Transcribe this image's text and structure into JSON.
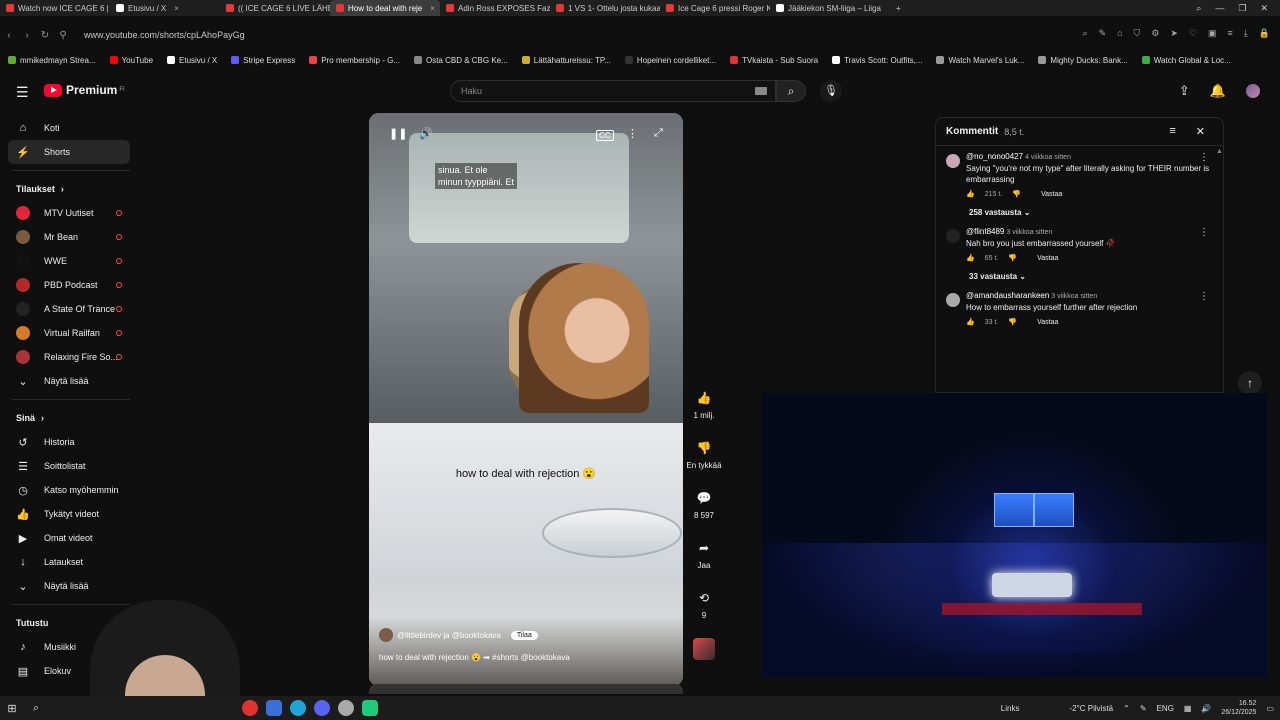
{
  "browser": {
    "tabs": [
      {
        "label": "Watch now ICE CAGE 6 | L",
        "color": "#e53935",
        "active": false
      },
      {
        "label": "Etusivu / X",
        "color": "#ffffff",
        "active": false
      },
      {
        "label": "(( ICE CAGE 6 LIVE LÄHE",
        "color": "#e53935",
        "active": false
      },
      {
        "label": "How to deal with reje",
        "color": "#e53935",
        "active": true
      },
      {
        "label": "Adin Ross EXPOSES Faze C",
        "color": "#e53935",
        "active": false
      },
      {
        "label": "1 VS 1- Ottelu josta kukaa",
        "color": "#e53935",
        "active": false
      },
      {
        "label": "Ice Cage 6 pressi Roger Ka",
        "color": "#e53935",
        "active": false
      },
      {
        "label": "Jääkiekon SM-liiga – Liiga",
        "color": "#ffffff",
        "active": false
      }
    ],
    "url": "www.youtube.com/shorts/cpLAhoPayGg",
    "bookmarks": [
      {
        "label": "mmikedmayn Strea...",
        "color": "#6a3"
      },
      {
        "label": "YouTube",
        "color": "#f00"
      },
      {
        "label": "Etusivu / X",
        "color": "#fff"
      },
      {
        "label": "Stripe Express",
        "color": "#635bff"
      },
      {
        "label": "Pro membership - G...",
        "color": "#e44"
      },
      {
        "label": "Osta CBD & CBG Ke...",
        "color": "#888"
      },
      {
        "label": "Lättähattureissu: TP...",
        "color": "#ca3"
      },
      {
        "label": "Hopeinen cordelliket...",
        "color": "#333"
      },
      {
        "label": "TVkaista - Sub Suora",
        "color": "#d33"
      },
      {
        "label": "Travis Scott: Outfits,...",
        "color": "#fff"
      },
      {
        "label": "Watch Marvel's Luk...",
        "color": "#999"
      },
      {
        "label": "Mighty Ducks: Bank...",
        "color": "#999"
      },
      {
        "label": "Watch Global & Loc...",
        "color": "#4a4"
      }
    ]
  },
  "header": {
    "logo_text": "Premium",
    "logo_sup": "FI",
    "search_placeholder": "Haku"
  },
  "sidebar": {
    "main": [
      {
        "label": "Koti",
        "icon": "⌂",
        "name": "home"
      },
      {
        "label": "Shorts",
        "icon": "⚡",
        "name": "shorts"
      }
    ],
    "subs_title": "Tilaukset",
    "subs": [
      {
        "label": "MTV Uutiset",
        "color": "#e0263a"
      },
      {
        "label": "Mr Bean",
        "color": "#7a5a40"
      },
      {
        "label": "WWE",
        "color": "#111"
      },
      {
        "label": "PBD Podcast",
        "color": "#b02a2a"
      },
      {
        "label": "A State Of Trance",
        "color": "#222"
      },
      {
        "label": "Virtual Railfan",
        "color": "#d47a2a"
      },
      {
        "label": "Relaxing Fire So...",
        "color": "#a33"
      }
    ],
    "show_more": "Näytä lisää",
    "you_title": "Sinä",
    "you": [
      {
        "label": "Historia",
        "icon": "↺",
        "name": "history"
      },
      {
        "label": "Soittolistat",
        "icon": "☰",
        "name": "playlists"
      },
      {
        "label": "Katso myöhemmin",
        "icon": "◷",
        "name": "watch-later"
      },
      {
        "label": "Tykätyt videot",
        "icon": "👍",
        "name": "liked"
      },
      {
        "label": "Omat videot",
        "icon": "▶",
        "name": "your-videos"
      },
      {
        "label": "Lataukset",
        "icon": "↓",
        "name": "downloads"
      }
    ],
    "show_more2": "Näytä lisää",
    "explore_title": "Tutustu",
    "explore": [
      {
        "label": "Musiikki",
        "icon": "♪",
        "name": "music"
      },
      {
        "label": "Elokuv",
        "icon": "▤",
        "name": "movies"
      }
    ]
  },
  "player": {
    "subtitle_line1": "sinua.  Et ole",
    "subtitle_line2": "minun tyyppiäni.  Et",
    "caption": "how to deal with rejection 😮",
    "channel": "@littlebirdev ja @booktokava",
    "subscribe": "Tilaa",
    "description": "how to deal with rejection 😮 ➡ #shorts @booktokava"
  },
  "actions": {
    "likes": "1 milj.",
    "dislike": "En tykkää",
    "comments": "8 597",
    "share": "Jaa",
    "remix": "9"
  },
  "comments_panel": {
    "title": "Kommentit",
    "count": "8,5 t.",
    "items": [
      {
        "author": "@no_nono0427",
        "time": "4 viikkoa sitten",
        "text": "Saying \"you're not my type\" after literally asking for THEIR number is embarrassing",
        "likes": "215 t.",
        "reply": "Vastaa",
        "replies": "258 vastausta",
        "avatar": "#c9a7b5"
      },
      {
        "author": "@flint8489",
        "time": "3 viikkoa sitten",
        "text": "Nah bro you just embarrassed yourself 🥀",
        "likes": "65 t.",
        "reply": "Vastaa",
        "replies": "33 vastausta",
        "avatar": "#222"
      },
      {
        "author": "@amandausharankeen",
        "time": "3 viikkoa sitten",
        "text": "How to embarrass yourself further after rejection",
        "likes": "33 t.",
        "reply": "Vastaa",
        "replies": "",
        "avatar": "#aaa"
      }
    ]
  },
  "taskbar": {
    "links": "Links",
    "weather": "-2°C  Pilvistä",
    "lang": "ENG",
    "time": "16.52",
    "date": "26/12/2025"
  }
}
